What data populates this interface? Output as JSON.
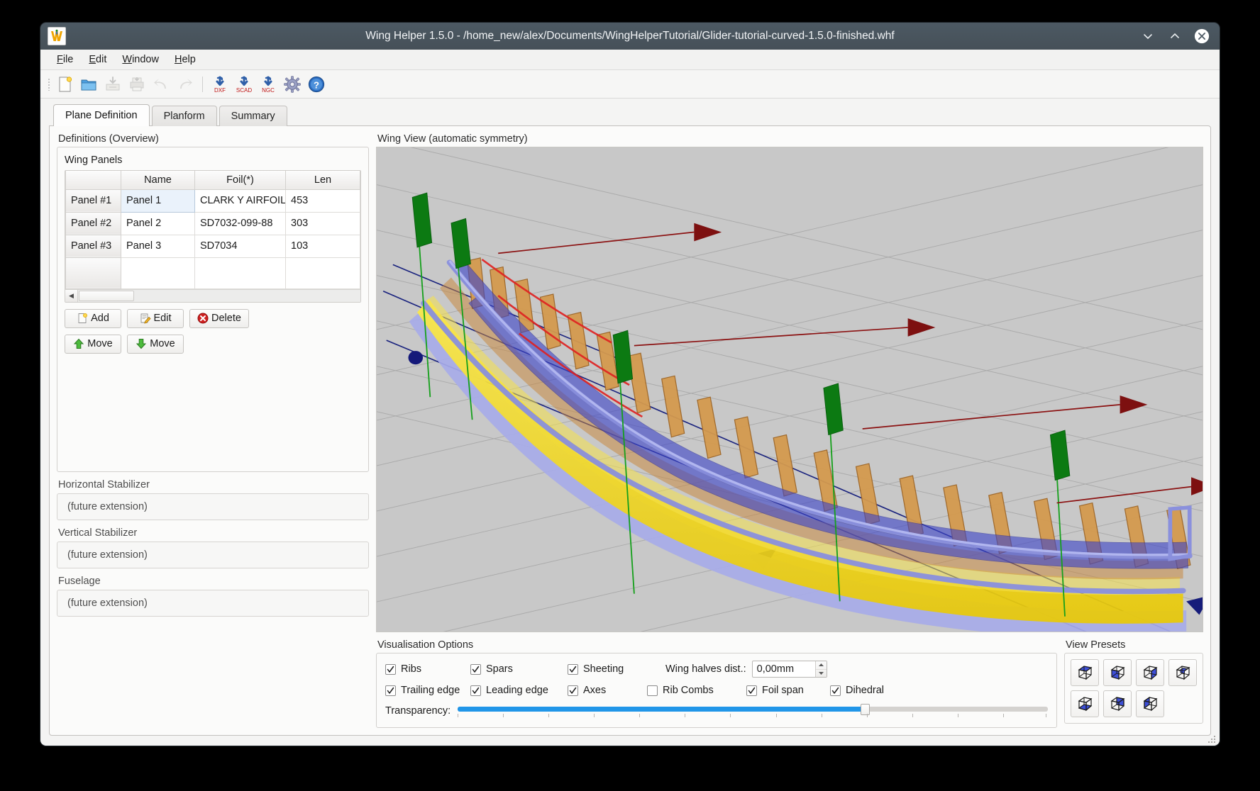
{
  "window": {
    "title": "Wing Helper 1.5.0 - /home_new/alex/Documents/WingHelperTutorial/Glider-tutorial-curved-1.5.0-finished.whf",
    "app_icon": "wing-helper-logo",
    "controls": {
      "minimize": "minimize-icon",
      "maximize": "maximize-icon",
      "close": "close-icon"
    }
  },
  "menu": {
    "items": [
      "File",
      "Edit",
      "Window",
      "Help"
    ]
  },
  "toolbar": {
    "buttons": [
      {
        "name": "new-file-icon",
        "label": "New"
      },
      {
        "name": "open-file-icon",
        "label": "Open"
      },
      {
        "name": "save-file-icon",
        "label": "Save"
      },
      {
        "name": "print-icon",
        "label": "Print"
      },
      {
        "name": "undo-icon",
        "label": "Undo"
      },
      {
        "name": "redo-icon",
        "label": "Redo"
      },
      {
        "name": "export-dxf-icon",
        "label": "DXF"
      },
      {
        "name": "export-scad-icon",
        "label": "SCAD"
      },
      {
        "name": "export-ngc-icon",
        "label": "NGC"
      },
      {
        "name": "settings-gear-icon",
        "label": "Settings"
      },
      {
        "name": "help-icon",
        "label": "Help"
      }
    ]
  },
  "tabs": [
    {
      "label": "Plane Definition",
      "active": true
    },
    {
      "label": "Planform",
      "active": false
    },
    {
      "label": "Summary",
      "active": false
    }
  ],
  "left": {
    "definitions_label": "Definitions (Overview)",
    "wing_panels_label": "Wing Panels",
    "table": {
      "columns": [
        "",
        "Name",
        "Foil(*)",
        "Len"
      ],
      "rows": [
        {
          "id": "Panel #1",
          "name": "Panel 1",
          "foil": "CLARK Y AIRFOIL",
          "len": "453"
        },
        {
          "id": "Panel #2",
          "name": "Panel 2",
          "foil": "SD7032-099-88",
          "len": "303"
        },
        {
          "id": "Panel #3",
          "name": "Panel 3",
          "foil": "SD7034",
          "len": "103"
        }
      ]
    },
    "buttons": {
      "add": "Add",
      "edit": "Edit",
      "delete": "Delete",
      "move_up": "Move",
      "move_down": "Move"
    },
    "sections": [
      {
        "label": "Horizontal Stabilizer",
        "value": "(future extension)"
      },
      {
        "label": "Vertical Stabilizer",
        "value": "(future extension)"
      },
      {
        "label": "Fuselage",
        "value": "(future extension)"
      }
    ]
  },
  "right": {
    "view_label": "Wing View (automatic symmetry)",
    "visualisation": {
      "title": "Visualisation Options",
      "row1": [
        {
          "label": "Ribs",
          "checked": true
        },
        {
          "label": "Spars",
          "checked": true
        },
        {
          "label": "Sheeting",
          "checked": true
        }
      ],
      "wing_halves_label": "Wing halves dist.:",
      "wing_halves_value": "0,00mm",
      "row2": [
        {
          "label": "Trailing edge",
          "checked": true
        },
        {
          "label": "Leading edge",
          "checked": true
        },
        {
          "label": "Axes",
          "checked": true
        },
        {
          "label": "Rib Combs",
          "checked": false
        },
        {
          "label": "Foil span",
          "checked": true
        },
        {
          "label": "Dihedral",
          "checked": true
        }
      ],
      "transparency_label": "Transparency:",
      "transparency_percent": 69
    },
    "view_presets": {
      "title": "View Presets",
      "items": [
        "view-preset-top",
        "view-preset-front-left",
        "view-preset-front",
        "view-preset-iso-small",
        "view-preset-bottom",
        "view-preset-right",
        "view-preset-left"
      ]
    }
  },
  "colors": {
    "accent": "#2196e8",
    "titlebar": "#4c5963",
    "viewport_bg": "#c8c8c8",
    "wing_sheeting": "#f5e02a",
    "wing_outline": "#9aa0e8",
    "ribs": "#c98a3c",
    "spars": "#3f46c8",
    "axis_red": "#8b1111",
    "axis_green": "#127a16",
    "axis_blue": "#1a237e"
  }
}
